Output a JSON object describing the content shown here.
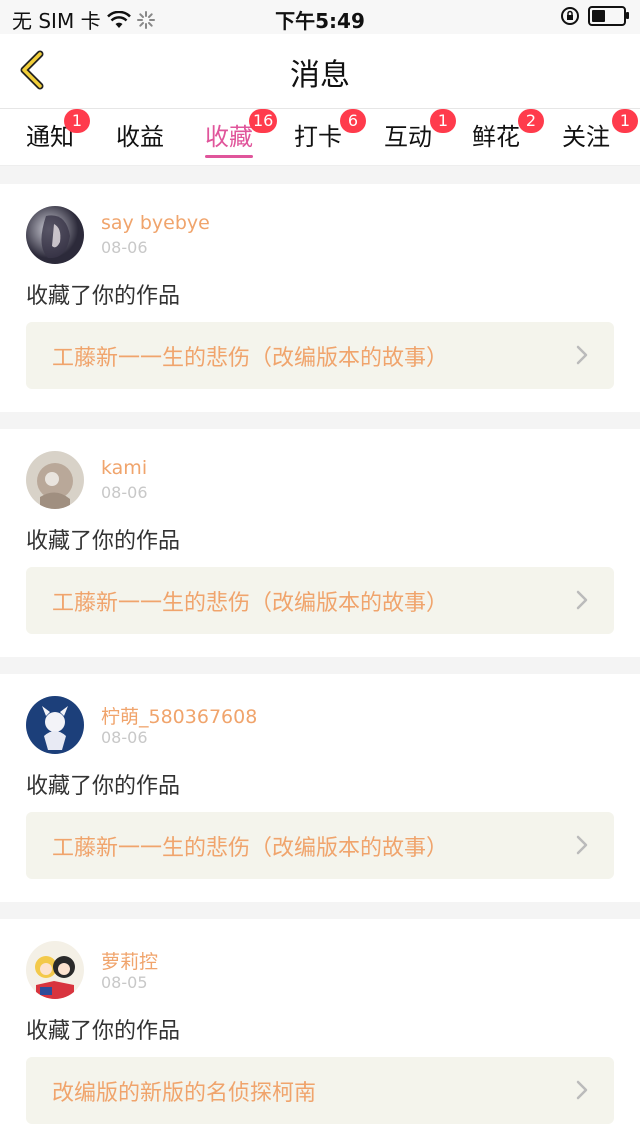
{
  "status": {
    "carrier": "无 SIM 卡",
    "time": "下午5:49"
  },
  "nav": {
    "title": "消息"
  },
  "tabs": [
    {
      "label": "通知",
      "badge": "1"
    },
    {
      "label": "收益",
      "badge": ""
    },
    {
      "label": "收藏",
      "badge": "16",
      "active": true
    },
    {
      "label": "打卡",
      "badge": "6"
    },
    {
      "label": "互动",
      "badge": "1"
    },
    {
      "label": "鲜花",
      "badge": "2"
    },
    {
      "label": "关注",
      "badge": "1"
    }
  ],
  "messages": [
    {
      "user": "say byebye",
      "date": "08-06",
      "action": "收藏了你的作品",
      "work": "工藤新一一生的悲伤（改编版本的故事）"
    },
    {
      "user": "kami",
      "date": "08-06",
      "action": "收藏了你的作品",
      "work": "工藤新一一生的悲伤（改编版本的故事）"
    },
    {
      "user": "柠萌_580367608",
      "date": "08-06",
      "action": "收藏了你的作品",
      "work": "工藤新一一生的悲伤（改编版本的故事）"
    },
    {
      "user": "萝莉控",
      "date": "08-05",
      "action": "收藏了你的作品",
      "work": "改编版的新版的名侦探柯南"
    }
  ],
  "colors": {
    "accent": "#e0559b",
    "username": "#f0a46c",
    "badge": "#ff3b4c"
  }
}
